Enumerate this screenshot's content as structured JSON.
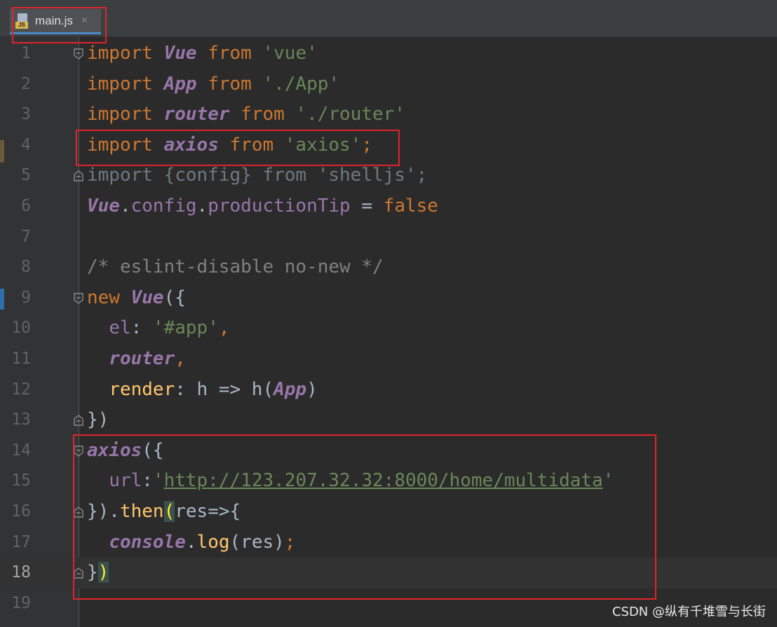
{
  "tab": {
    "name": "main.js",
    "close": "×",
    "icon": "js-file-icon"
  },
  "colors": {
    "keyword": "#cc7832",
    "class": "#9876aa",
    "string": "#6a8759",
    "comment": "#808080",
    "highlight_box": "#e0242b"
  },
  "lines": [
    {
      "n": "1",
      "parts": [
        [
          "kw",
          "import "
        ],
        [
          "cls",
          "Vue"
        ],
        [
          "kw",
          " from "
        ],
        [
          "str",
          "'vue'"
        ]
      ]
    },
    {
      "n": "2",
      "parts": [
        [
          "kw",
          "import "
        ],
        [
          "cls",
          "App"
        ],
        [
          "kw",
          " from "
        ],
        [
          "str",
          "'./App'"
        ]
      ]
    },
    {
      "n": "3",
      "parts": [
        [
          "kw",
          "import "
        ],
        [
          "cls",
          "router"
        ],
        [
          "kw",
          " from "
        ],
        [
          "str",
          "'./router'"
        ]
      ]
    },
    {
      "n": "4",
      "parts": [
        [
          "kw",
          "import "
        ],
        [
          "cls",
          "axios"
        ],
        [
          "kw",
          " from "
        ],
        [
          "str",
          "'axios'"
        ],
        [
          "kw",
          ";"
        ]
      ]
    },
    {
      "n": "5",
      "parts": [
        [
          "dim",
          "import {config} from 'shelljs';"
        ]
      ]
    },
    {
      "n": "6",
      "parts": [
        [
          "cls",
          "Vue"
        ],
        [
          "txt",
          "."
        ],
        [
          "prop",
          "config"
        ],
        [
          "txt",
          "."
        ],
        [
          "prop",
          "productionTip"
        ],
        [
          "txt",
          " = "
        ],
        [
          "kw",
          "false"
        ]
      ]
    },
    {
      "n": "7",
      "parts": []
    },
    {
      "n": "8",
      "parts": [
        [
          "cmt",
          "/* eslint-disable no-new */"
        ]
      ]
    },
    {
      "n": "9",
      "parts": [
        [
          "kw",
          "new "
        ],
        [
          "cls",
          "Vue"
        ],
        [
          "txt",
          "({"
        ]
      ]
    },
    {
      "n": "10",
      "parts": [
        [
          "txt",
          "  "
        ],
        [
          "prop",
          "el"
        ],
        [
          "txt",
          ": "
        ],
        [
          "str",
          "'#app'"
        ],
        [
          "kw",
          ","
        ]
      ]
    },
    {
      "n": "11",
      "parts": [
        [
          "txt",
          "  "
        ],
        [
          "cls",
          "router"
        ],
        [
          "kw",
          ","
        ]
      ]
    },
    {
      "n": "12",
      "parts": [
        [
          "txt",
          "  "
        ],
        [
          "fn",
          "render"
        ],
        [
          "txt",
          ": h => h("
        ],
        [
          "cls",
          "App"
        ],
        [
          "txt",
          ")"
        ]
      ]
    },
    {
      "n": "13",
      "parts": [
        [
          "txt",
          "})"
        ]
      ]
    },
    {
      "n": "14",
      "parts": [
        [
          "cls",
          "axios"
        ],
        [
          "txt",
          "({"
        ]
      ]
    },
    {
      "n": "15",
      "parts": [
        [
          "txt",
          "  "
        ],
        [
          "prop",
          "url"
        ],
        [
          "txt",
          ":"
        ],
        [
          "str",
          "'"
        ],
        [
          "url",
          "http://123.207.32.32:8000/home/multidata"
        ],
        [
          "str",
          "'"
        ]
      ]
    },
    {
      "n": "16",
      "parts": [
        [
          "txt",
          "})."
        ],
        [
          "fn",
          "then"
        ],
        [
          "hl",
          "("
        ],
        [
          "txt",
          "res=>{"
        ]
      ]
    },
    {
      "n": "17",
      "parts": [
        [
          "txt",
          "  "
        ],
        [
          "cls",
          "console"
        ],
        [
          "txt",
          "."
        ],
        [
          "fn",
          "log"
        ],
        [
          "txt",
          "(res)"
        ],
        [
          "kw",
          ";"
        ]
      ]
    },
    {
      "n": "18",
      "parts": [
        [
          "txt",
          "}"
        ],
        [
          "hl",
          ")"
        ]
      ]
    },
    {
      "n": "19",
      "parts": []
    }
  ],
  "watermark": "CSDN @纵有千堆雪与长街"
}
